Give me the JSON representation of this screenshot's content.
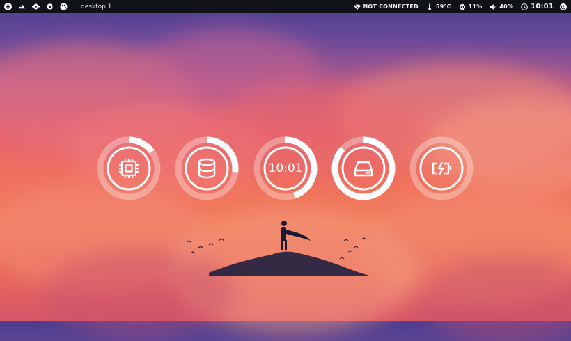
{
  "topbar": {
    "workspace_label": "desktop 1",
    "left_icons": [
      "add-icon",
      "cloud-icon",
      "gear-icon",
      "settings-icon",
      "palette-icon"
    ],
    "network": "NOT CONNECTED",
    "temperature": "59°C",
    "cpu_load": "11%",
    "volume": "40%",
    "time": "10:01"
  },
  "widgets": [
    {
      "name": "cpu",
      "icon": "cpu-icon",
      "level": 0.15
    },
    {
      "name": "memory",
      "icon": "database-icon",
      "level": 0.27
    },
    {
      "name": "clock",
      "icon": "",
      "text": "10:01",
      "level": 0.45
    },
    {
      "name": "disk",
      "icon": "hard-drive-icon",
      "level": 0.87
    },
    {
      "name": "battery",
      "icon": "battery-charging-icon",
      "level": 0.0
    }
  ],
  "colors": {
    "bar_bg": "#111217",
    "ring_track": "rgba(255,255,255,0.35)",
    "ring_fill": "#ffffff"
  }
}
